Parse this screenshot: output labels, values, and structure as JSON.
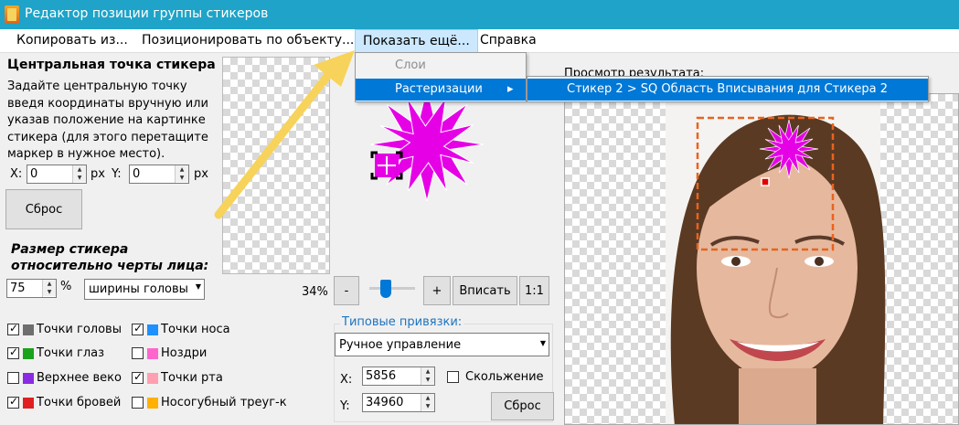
{
  "window": {
    "title": "Редактор позиции группы стикеров"
  },
  "menu": {
    "items": [
      "Копировать из...",
      "Позиционировать по объекту...",
      "Показать ещё...",
      "Справка"
    ],
    "dropdown": {
      "layers": "Слои",
      "rasterize": "Растеризации",
      "arrow": "▸"
    },
    "submenu": {
      "item": "Стикер 2 > SQ Область Вписывания для Стикера 2"
    }
  },
  "center": {
    "heading": "Центральная точка стикера",
    "description": [
      "Задайте центральную точку",
      "введя координаты вручную или",
      "указав положение на картинке",
      "стикера (для этого перетащите",
      "маркер в нужное место)."
    ],
    "x_label": "X:",
    "x_value": "0",
    "x_unit": "px",
    "y_label": "Y:",
    "y_value": "0",
    "y_unit": "px",
    "reset_label": "Сброс"
  },
  "size": {
    "heading_line1": "Размер стикера",
    "heading_line2": "относительно черты лица:",
    "value": "75",
    "unit": "%",
    "relative_to": "ширины головы"
  },
  "zoom": {
    "percent": "34%",
    "minus": "-",
    "plus": "+",
    "fit": "Вписать",
    "one_to_one": "1:1",
    "slider_level": 0.3
  },
  "checkboxes": [
    {
      "label": "Точки головы",
      "checked": true,
      "color": "#6e6e6e"
    },
    {
      "label": "Точки носа",
      "checked": true,
      "color": "#1e90ff"
    },
    {
      "label": "Точки глаз",
      "checked": true,
      "color": "#1aa31a"
    },
    {
      "label": "Ноздри",
      "checked": false,
      "color": "#ff66cc"
    },
    {
      "label": "Верхнее веко",
      "checked": false,
      "color": "#8a2be2"
    },
    {
      "label": "Точки рта",
      "checked": true,
      "color": "#ff9fb0"
    },
    {
      "label": "Точки бровей",
      "checked": true,
      "color": "#e02020"
    },
    {
      "label": "Носогубный треуг-к",
      "checked": false,
      "color": "#ffb000"
    }
  ],
  "snapping": {
    "label": "Типовые привязки:",
    "mode": "Ручное управление",
    "x_label": "X:",
    "x_value": "5856",
    "y_label": "Y:",
    "y_value": "34960",
    "slide_label": "Скольжение",
    "reset_label": "Сброс"
  },
  "preview": {
    "label": "Просмотр результата:"
  },
  "colors": {
    "titlebar": "#1fa3c8",
    "sticker": "#e600e6",
    "highlight": "#0078d7",
    "guide_arrow": "#f7d35c",
    "frame": "#e8631f"
  }
}
